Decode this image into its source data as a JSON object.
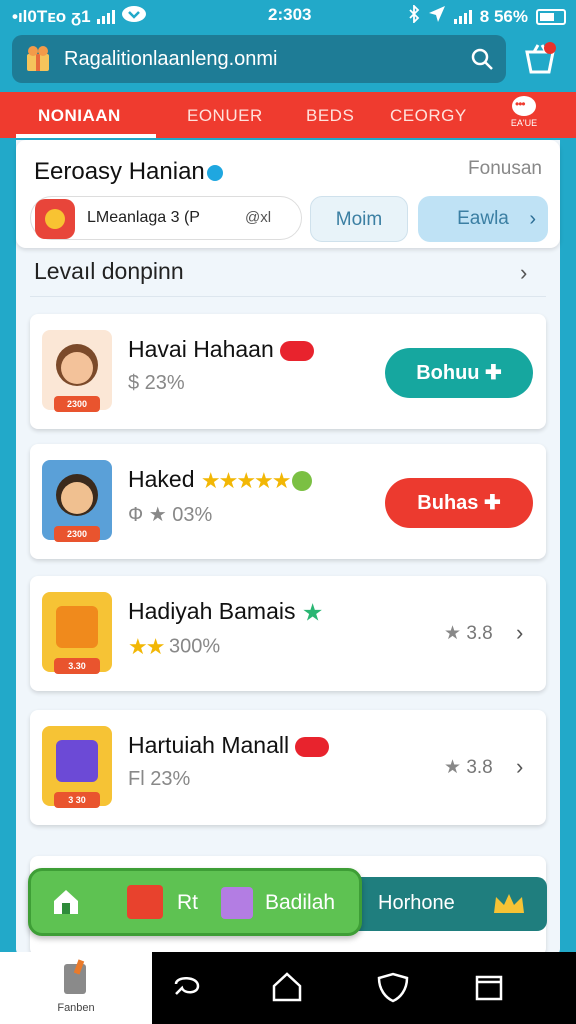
{
  "status_bar": {
    "left": "•ıl0Tᴇo ᵹ1",
    "time": "2:303",
    "right": "8 56%"
  },
  "search": {
    "value": "Ragalitionlaanleng.onmi"
  },
  "tabs": [
    {
      "label": "NONIAAN"
    },
    {
      "label": "EONUER"
    },
    {
      "label": "BEDS"
    },
    {
      "label": "CEORGY"
    }
  ],
  "tab_more": {
    "label": "EA'UE"
  },
  "header_card": {
    "title": "Eeroasy Hanian",
    "side_label": "Fonusan",
    "profile_name": "LMeanlaga 3 (P",
    "profile_tag": "@xl",
    "pill_1": "Moim",
    "pill_2": "Eawla"
  },
  "section": {
    "title": "Levaıl donpinn"
  },
  "items": [
    {
      "title": "Havai Hahaan",
      "subtitle": "$ 23%",
      "badge": "2300",
      "action": "Bohuu ✚"
    },
    {
      "title": "Haked",
      "subtitle": "Ф ★ 03%",
      "badge": "2300",
      "action": "Buhas ✚"
    },
    {
      "title": "Hadiyah Bamais",
      "subtitle": "300%",
      "badge": "3.30",
      "rating": "3.8"
    },
    {
      "title": "Hartuiah Manall",
      "subtitle": "Fl 23%",
      "badge": "3 30",
      "rating": "3.8"
    }
  ],
  "bottom_bar": {
    "rt": "Rt",
    "badiah": "Badilah",
    "horhone": "Horhone"
  },
  "sys_nav": {
    "fan_label": "Fanben"
  },
  "colors": {
    "brand_red": "#ef3b2f",
    "teal": "#16a79f",
    "sky": "#22a9c9",
    "green": "#5ec252"
  }
}
